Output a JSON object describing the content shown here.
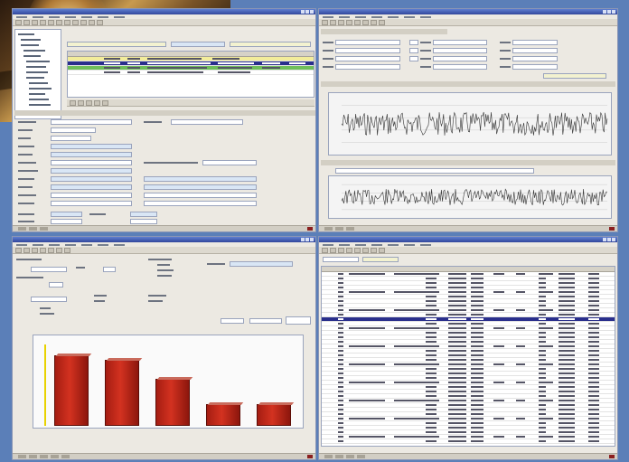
{
  "windows": [
    {
      "id": "record-editor",
      "title": "",
      "status": ""
    },
    {
      "id": "chart-viewer",
      "title": "",
      "status": ""
    },
    {
      "id": "bar-report",
      "title": "",
      "status": ""
    },
    {
      "id": "results-table",
      "title": "",
      "status": ""
    }
  ],
  "colors": {
    "desktop": "#5b7fb8",
    "titlebar": "#31469c",
    "window": "#ece9e2",
    "bar": "#c62a1a",
    "highlight": "#2a2f8c"
  },
  "bar_report": {
    "chart_data": {
      "type": "bar",
      "categories": [
        "",
        "",
        "",
        "",
        ""
      ],
      "values": [
        100,
        93,
        67,
        31,
        31
      ],
      "title": "",
      "xlabel": "",
      "ylabel": "",
      "ylim": [
        0,
        110
      ],
      "grid": false
    }
  },
  "chart_viewer": {
    "chart_data": [
      {
        "type": "line",
        "title": "",
        "xlabel": "",
        "ylabel": "",
        "grid": true
      },
      {
        "type": "line",
        "title": "",
        "xlabel": "",
        "ylabel": "",
        "grid": true
      }
    ]
  }
}
